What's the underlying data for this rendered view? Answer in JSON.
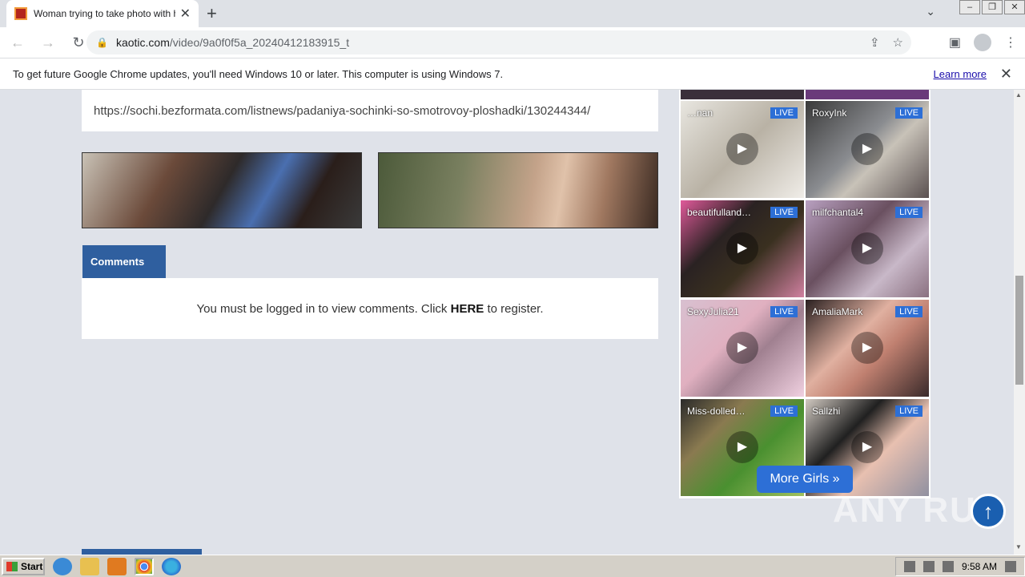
{
  "browser": {
    "tab_title": "Woman trying to take photo with he",
    "url_host": "kaotic.com",
    "url_path": "/video/9a0f0f5a_20240412183915_t",
    "close_tab": "✕",
    "new_tab": "+"
  },
  "infobar": {
    "message": "To get future Google Chrome updates, you'll need Windows 10 or later. This computer is using Windows 7.",
    "learn_more": "Learn more"
  },
  "page": {
    "link_text": "https://sochi.bezformata.com/listnews/padaniya-sochinki-so-smotrovoy-ploshadki/130244344/",
    "comments_tab": "Comments",
    "comments_msg_before": "You must be logged in to view comments. Click ",
    "comments_msg_link": "HERE",
    "comments_msg_after": " to register."
  },
  "cams": {
    "live_label": "LIVE",
    "items": [
      {
        "name": "…nan"
      },
      {
        "name": "RoxyInk"
      },
      {
        "name": "beautifulland…"
      },
      {
        "name": "milfchantal4"
      },
      {
        "name": "SexyJulia21"
      },
      {
        "name": "AmaliaMark"
      },
      {
        "name": "Miss-dolled…"
      },
      {
        "name": "Sallzhi"
      }
    ],
    "more_girls": "More Girls »"
  },
  "watermark": "ANY RUN",
  "taskbar": {
    "start": "Start",
    "clock": "9:58 AM"
  }
}
